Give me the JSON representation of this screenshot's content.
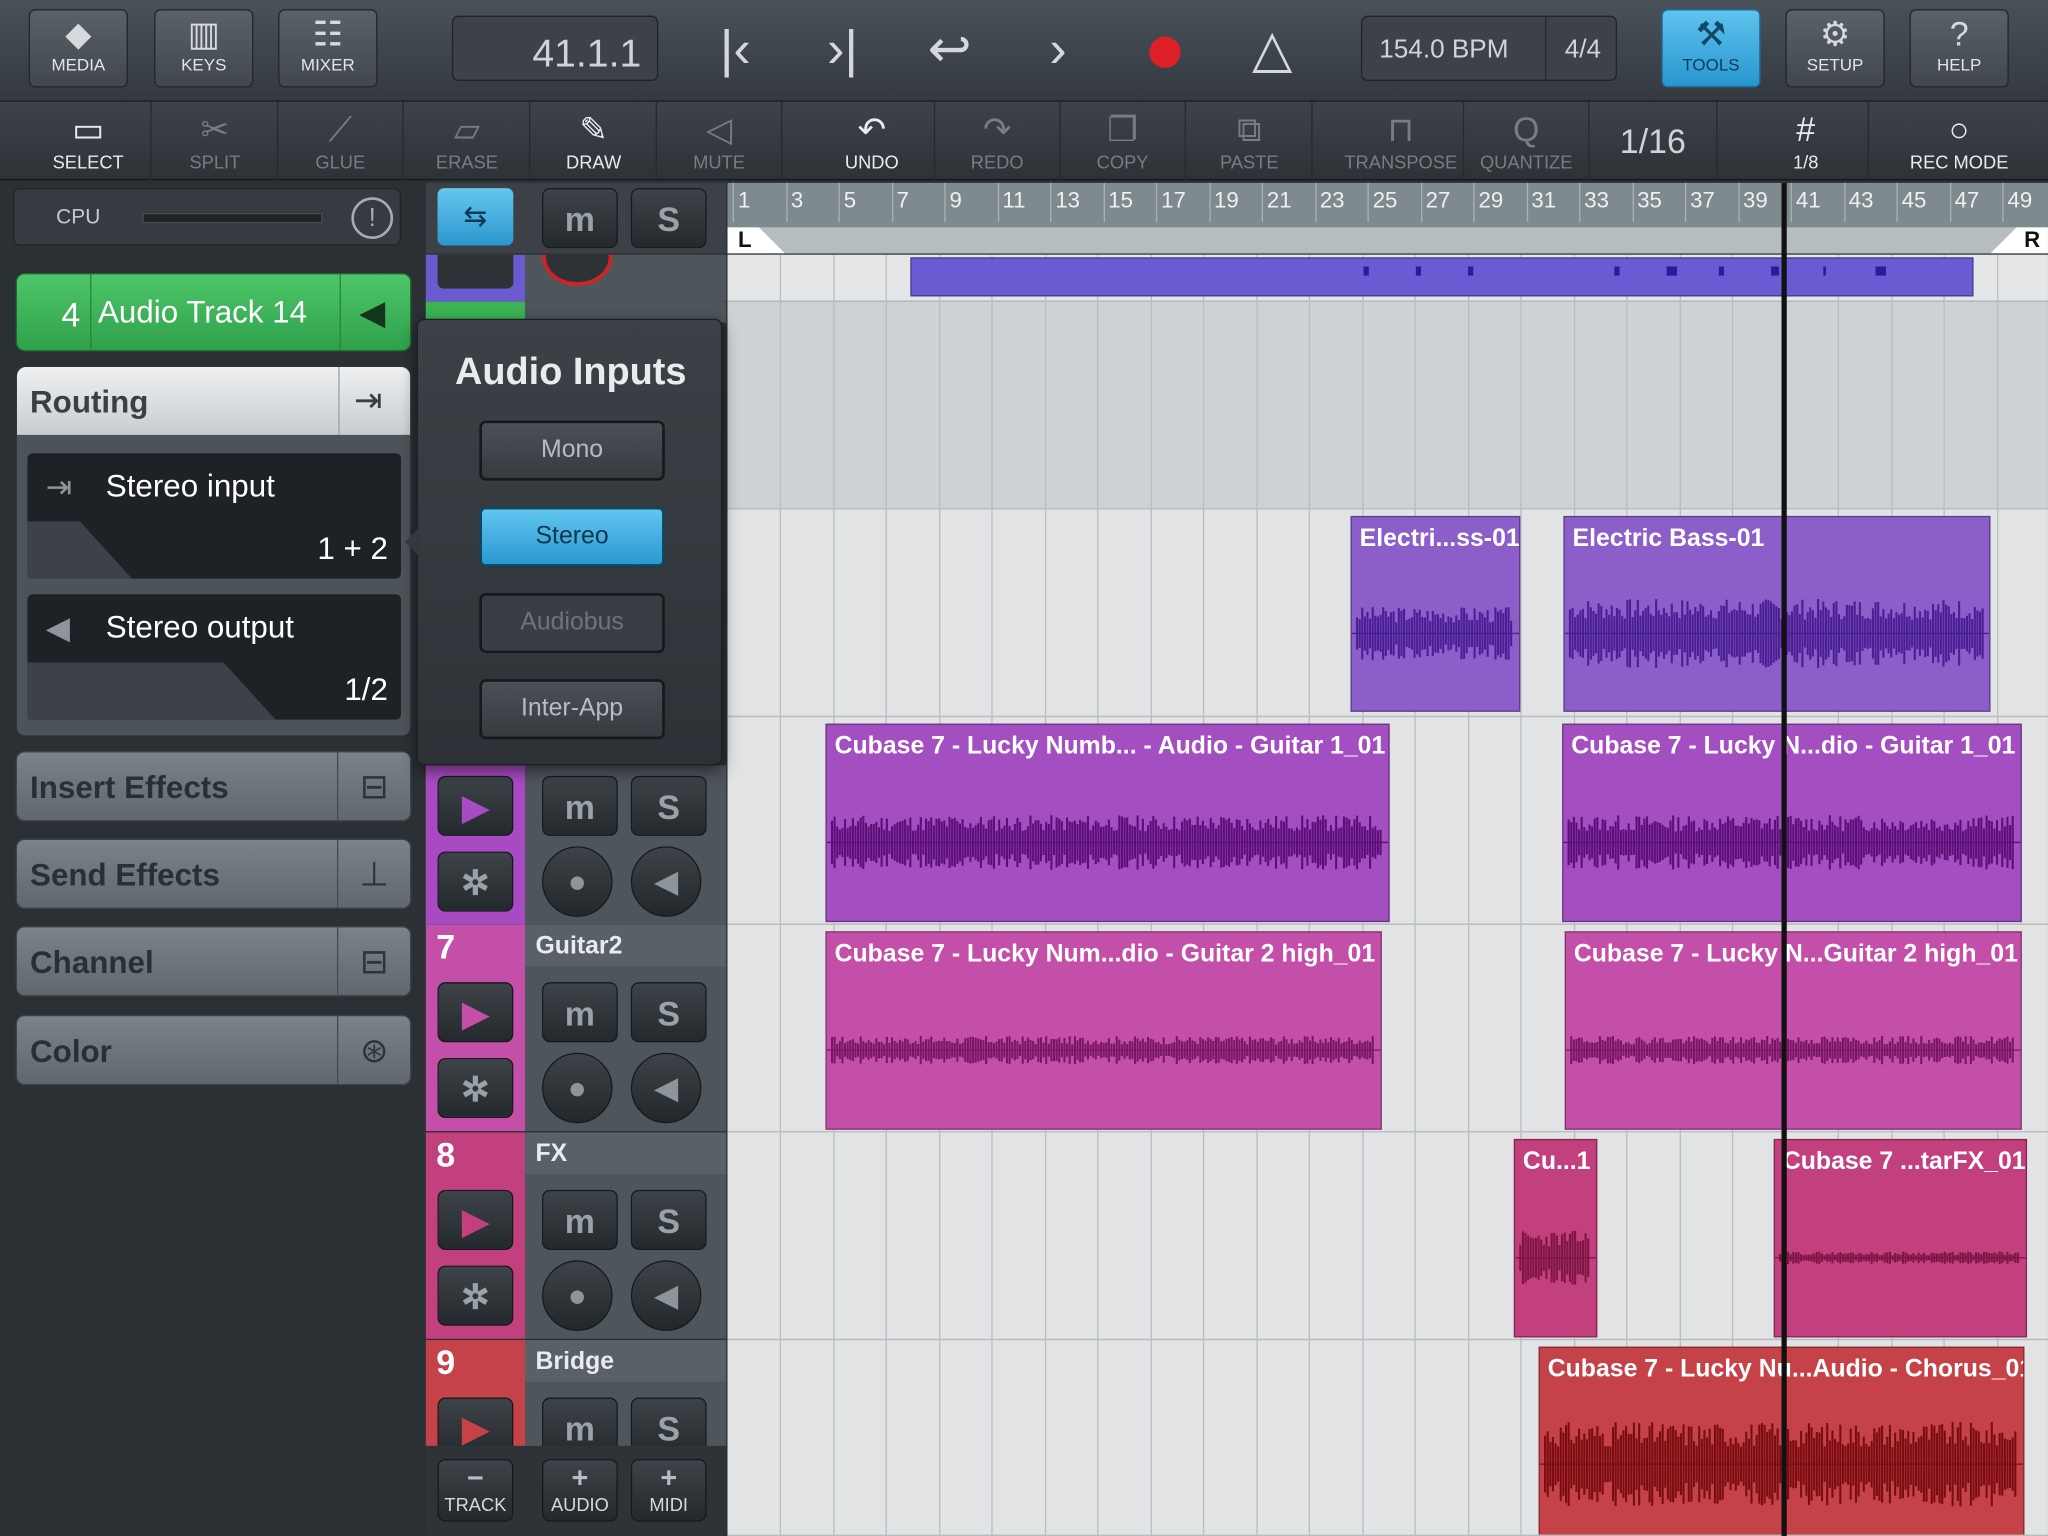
{
  "top_toolbar": {
    "media": "MEDIA",
    "keys": "KEYS",
    "mixer": "MIXER",
    "position": "41.1.1",
    "tempo": "154.0 BPM",
    "signature": "4/4",
    "tools": "TOOLS",
    "setup": "SETUP",
    "help": "HELP"
  },
  "edit_toolbar": {
    "select": "SELECT",
    "split": "SPLIT",
    "glue": "GLUE",
    "erase": "ERASE",
    "draw": "DRAW",
    "mute": "MUTE",
    "undo": "UNDO",
    "redo": "REDO",
    "copy": "COPY",
    "paste": "PASTE",
    "transpose": "TRANSPOSE",
    "quantize": "QUANTIZE",
    "quantize_value": "1/16",
    "grid_value": "1/8",
    "rec_mode": "REC MODE"
  },
  "cpu": {
    "label": "CPU",
    "load": 0.0
  },
  "inspector": {
    "track_number": "4",
    "track_name": "Audio Track 14",
    "track_color": "#3cb455",
    "routing": "Routing",
    "input_label": "Stereo input",
    "input_value": "1 + 2",
    "output_label": "Stereo output",
    "output_value": "1/2",
    "insert_effects": "Insert Effects",
    "send_effects": "Send Effects",
    "channel": "Channel",
    "color": "Color"
  },
  "audio_inputs_popup": {
    "title": "Audio Inputs",
    "options": [
      "Mono",
      "Stereo",
      "Audiobus",
      "Inter-App"
    ],
    "selected": "Stereo",
    "disabled": "Audiobus"
  },
  "ruler": {
    "ticks": [
      "1",
      "3",
      "5",
      "7",
      "9",
      "11",
      "13",
      "15",
      "17",
      "19",
      "21",
      "23",
      "25",
      "27",
      "29",
      "31",
      "33",
      "35",
      "37",
      "39",
      "41",
      "43",
      "45",
      "47",
      "49"
    ],
    "left_locator": "L",
    "right_locator": "R"
  },
  "tracks": [
    {
      "number": "7",
      "name": "Guitar2",
      "color": "#c44fa8"
    },
    {
      "number": "8",
      "name": "FX",
      "color": "#c3407e"
    },
    {
      "number": "9",
      "name": "Bridge",
      "color": "#c44248"
    }
  ],
  "clips": {
    "bass_a": "Electri...ss-01",
    "bass_b": "Electric Bass-01",
    "guitar1_a": "Cubase 7 - Lucky Numb... - Audio - Guitar 1_01",
    "guitar1_b": "Cubase 7 - Lucky N...dio - Guitar 1_01",
    "guitar2_a": "Cubase 7 - Lucky Num...dio - Guitar 2 high_01",
    "guitar2_b": "Cubase 7 - Lucky N...Guitar 2 high_01",
    "fx_a": "Cu...1",
    "fx_b": "Cubase 7 ...tarFX_01",
    "chorus": "Cubase 7 - Lucky Nu...Audio - Chorus_01"
  },
  "bottom_bar": {
    "track": "TRACK",
    "audio": "AUDIO",
    "midi": "MIDI"
  }
}
